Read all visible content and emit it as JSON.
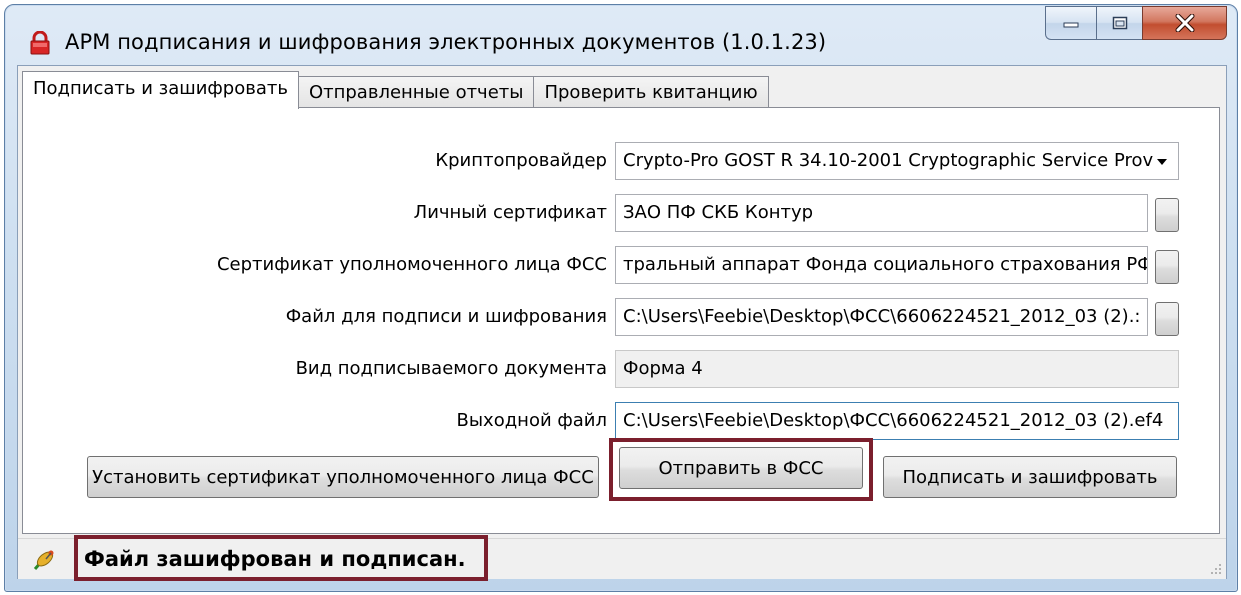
{
  "window": {
    "title": "АРМ подписания и шифрования электронных документов (1.0.1.23)",
    "icon": "padlock-icon",
    "controls": [
      "minimize-icon",
      "maximize-icon",
      "close-icon"
    ]
  },
  "tabs": [
    {
      "label": "Подписать и зашифровать",
      "active": true
    },
    {
      "label": "Отправленные отчеты",
      "active": false
    },
    {
      "label": "Проверить квитанцию",
      "active": false
    }
  ],
  "form": {
    "crypto_provider": {
      "label": "Криптопровайдер",
      "value": "Crypto-Pro GOST R 34.10-2001 Cryptographic Service Prov"
    },
    "personal_certificate": {
      "label": "Личный сертификат",
      "value": "ЗАО ПФ СКБ Контур"
    },
    "fss_certificate": {
      "label": "Сертификат уполномоченного лица ФСС",
      "value": "тральный аппарат Фонда социального страхования РФ"
    },
    "input_file": {
      "label": "Файл для подписи и шифрования",
      "value": "C:\\Users\\Feebie\\Desktop\\ФСС\\6606224521_2012_03 (2).:"
    },
    "document_type": {
      "label": "Вид подписываемого документа",
      "value": "Форма 4"
    },
    "output_file": {
      "label": "Выходной файл",
      "value": "C:\\Users\\Feebie\\Desktop\\ФСС\\6606224521_2012_03 (2).ef4"
    }
  },
  "buttons": {
    "install_cert": "Установить сертификат уполномоченного лица ФСС",
    "send_fss": "Отправить в ФСС",
    "sign_encrypt": "Подписать и зашифровать"
  },
  "status": {
    "text": "Файл зашифрован и подписан.",
    "icon": "satellite-dish-icon"
  },
  "colors": {
    "highlight": "#7b1f2d",
    "close_button": "#c24e30"
  }
}
